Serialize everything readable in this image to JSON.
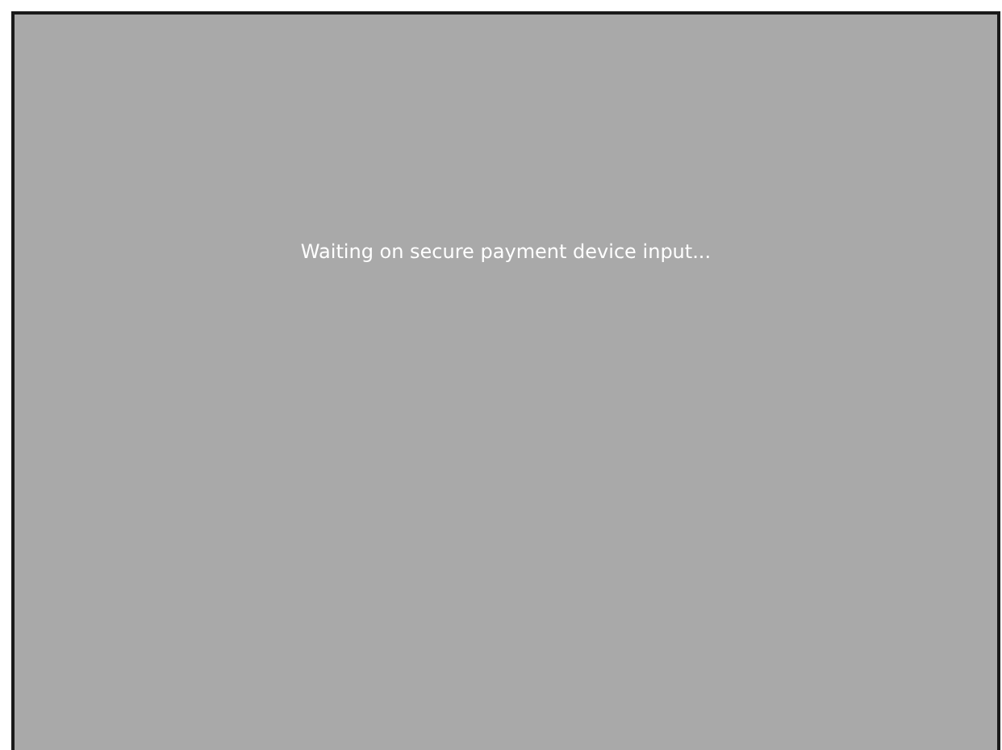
{
  "status_message": "Waiting on secure payment device input..."
}
